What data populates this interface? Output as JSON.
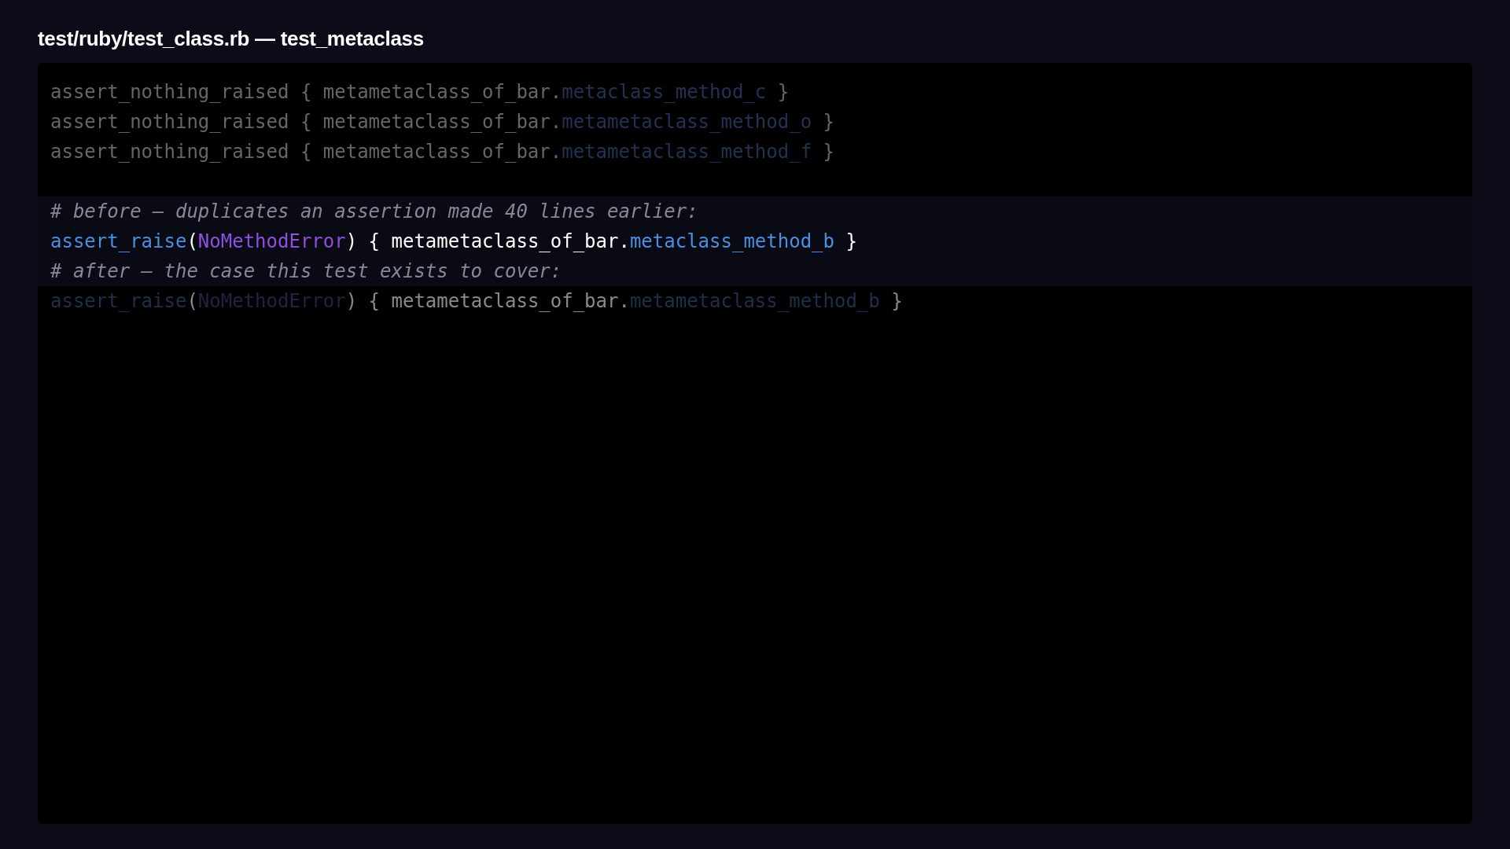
{
  "title": "test/ruby/test_class.rb — test_metaclass",
  "lines": [
    {
      "kind": "context",
      "highlighted": false,
      "tokens": [
        {
          "kind": "plain",
          "text": "assert_nothing_raised { metametaclass_of_bar."
        },
        {
          "kind": "method",
          "text": "metaclass_method_c"
        },
        {
          "kind": "plain",
          "text": " }"
        }
      ]
    },
    {
      "kind": "context",
      "highlighted": false,
      "tokens": [
        {
          "kind": "plain",
          "text": "assert_nothing_raised { metametaclass_of_bar."
        },
        {
          "kind": "method",
          "text": "metametaclass_method_o"
        },
        {
          "kind": "plain",
          "text": " }"
        }
      ]
    },
    {
      "kind": "context",
      "highlighted": false,
      "tokens": [
        {
          "kind": "plain",
          "text": "assert_nothing_raised { metametaclass_of_bar."
        },
        {
          "kind": "method",
          "text": "metametaclass_method_f"
        },
        {
          "kind": "plain",
          "text": " }"
        }
      ]
    },
    {
      "kind": "blank",
      "highlighted": false
    },
    {
      "kind": "focus",
      "highlighted": true,
      "tokens": [
        {
          "kind": "comment",
          "text": "# before — duplicates an assertion made 40 lines earlier:"
        }
      ]
    },
    {
      "kind": "focus",
      "highlighted": true,
      "tokens": [
        {
          "kind": "function",
          "text": "assert_raise"
        },
        {
          "kind": "plain",
          "text": "("
        },
        {
          "kind": "constant",
          "text": "NoMethodError"
        },
        {
          "kind": "plain",
          "text": ") { metametaclass_of_bar."
        },
        {
          "kind": "method",
          "text": "metaclass_method_b"
        },
        {
          "kind": "plain",
          "text": " }"
        }
      ]
    },
    {
      "kind": "focus",
      "highlighted": true,
      "tokens": [
        {
          "kind": "comment",
          "text": "# after — the case this test exists to cover:"
        }
      ]
    },
    {
      "kind": "ghost",
      "highlighted": false,
      "tokens": [
        {
          "kind": "function",
          "text": "assert_raise"
        },
        {
          "kind": "plain",
          "text": "("
        },
        {
          "kind": "constant",
          "text": "NoMethodError"
        },
        {
          "kind": "plain",
          "text": ") { metametaclass_of_bar."
        },
        {
          "kind": "method",
          "text": "metametaclass_method_b"
        },
        {
          "kind": "plain",
          "text": " }"
        }
      ]
    }
  ]
}
